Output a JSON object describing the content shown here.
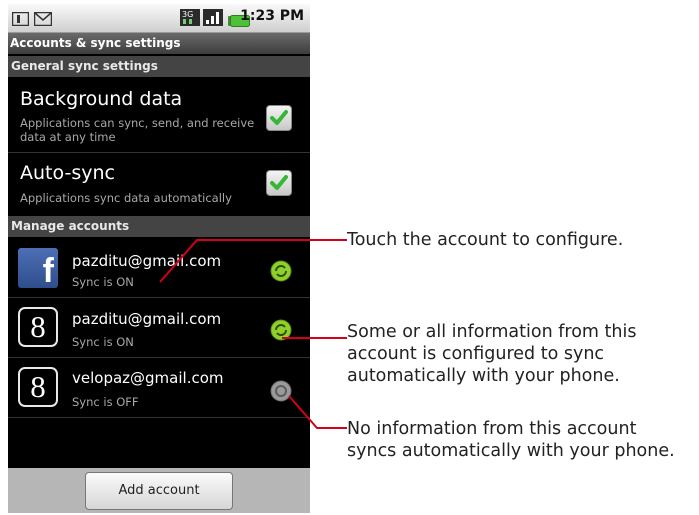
{
  "status_bar": {
    "time": "1:23 PM",
    "left_icons": [
      "notification-icon",
      "gmail-icon"
    ],
    "right_icons": [
      "3g-icon",
      "signal-icon",
      "battery-icon"
    ]
  },
  "title_bar": {
    "title": "Accounts & sync settings"
  },
  "general_sync": {
    "header": "General sync settings",
    "items": [
      {
        "title": "Background data",
        "subtitle": "Applications can sync, send, and receive data at any time",
        "checked": true
      },
      {
        "title": "Auto-sync",
        "subtitle": "Applications sync data automatically",
        "checked": true
      }
    ]
  },
  "manage_accounts": {
    "header": "Manage accounts",
    "accounts": [
      {
        "type": "facebook",
        "email": "pazditu@gmail.com",
        "status": "Sync is ON",
        "sync_state": "on"
      },
      {
        "type": "google",
        "email": "pazditu@gmail.com",
        "status": "Sync is ON",
        "sync_state": "on"
      },
      {
        "type": "google",
        "email": "velopaz@gmail.com",
        "status": "Sync is OFF",
        "sync_state": "off"
      }
    ]
  },
  "bottom": {
    "add_account_label": "Add account"
  },
  "callouts": {
    "configure": "Touch the account to configure.",
    "sync_on": [
      "Some or all information from this",
      "account is configured to sync",
      "automatically with your phone."
    ],
    "sync_off": [
      "No information from this account",
      "syncs automatically with your phone."
    ]
  },
  "colors": {
    "callout_line": "#d4001a",
    "sync_on": "#8fd12a",
    "sync_off": "#8f8f8f",
    "check": "#35b735"
  },
  "icons": {
    "facebook_glyph": "f",
    "google_glyph": "8"
  }
}
